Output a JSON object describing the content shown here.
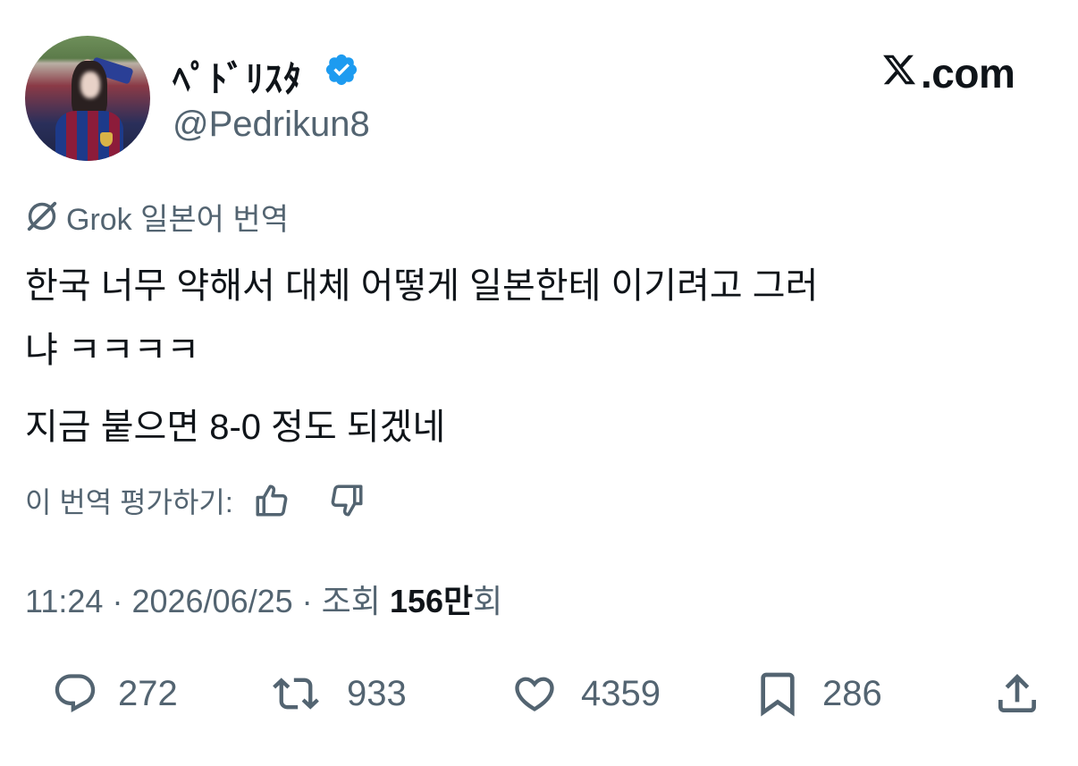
{
  "author": {
    "display_name": "ﾍﾟﾄﾞﾘｽﾀ",
    "handle": "@Pedrikun8",
    "verified": true
  },
  "site": {
    "label": ".com",
    "logo_icon": "x-logo-icon"
  },
  "translation": {
    "label": "Grok 일본어 번역",
    "icon": "grok-icon"
  },
  "tweet": {
    "line1": "한국 너무 약해서 대체 어떻게 일본한테 이기려고 그러",
    "line2": "냐 ㅋㅋㅋㅋ",
    "line3": "지금 붙으면 8-0 정도 되겠네"
  },
  "rating": {
    "label": "이 번역 평가하기:",
    "thumbs_up_icon": "thumbs-up-icon",
    "thumbs_down_icon": "thumbs-down-icon"
  },
  "meta": {
    "time": "11:24",
    "date": "2026/06/25",
    "views_label": "조회",
    "views_count": "156만",
    "views_suffix": "회",
    "separator": "·"
  },
  "actions": {
    "replies": "272",
    "reposts": "933",
    "likes": "4359",
    "bookmarks": "286"
  },
  "colors": {
    "text": "#0f1419",
    "secondary": "#536471",
    "verified": "#1d9bf0"
  }
}
